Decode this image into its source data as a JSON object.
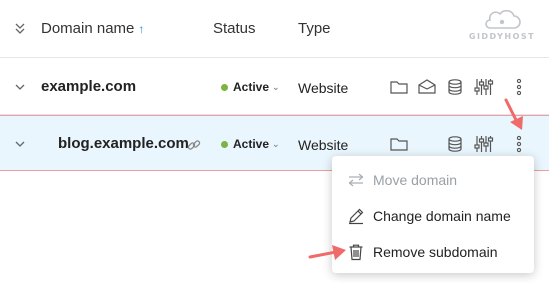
{
  "header": {
    "domain_col": "Domain name",
    "sort_indicator": "↑",
    "status_col": "Status",
    "type_col": "Type"
  },
  "logo": {
    "text": "GIDDYHOST",
    "icon": "cloud-logo-icon"
  },
  "rows": [
    {
      "domain": "example.com",
      "status": "Active",
      "type": "Website",
      "subdomain": false
    },
    {
      "domain": "blog.example.com",
      "status": "Active",
      "type": "Website",
      "subdomain": true
    }
  ],
  "menu": {
    "items": [
      {
        "label": "Move domain",
        "icon": "swap-icon",
        "disabled": true
      },
      {
        "label": "Change domain name",
        "icon": "pencil-icon",
        "disabled": false
      },
      {
        "label": "Remove subdomain",
        "icon": "trash-icon",
        "disabled": false
      }
    ]
  },
  "colors": {
    "accent": "#2a8bd8",
    "status_active": "#7cb342",
    "selected_row_bg": "#eaf6fd",
    "annotation_arrow": "#f06a6a"
  }
}
